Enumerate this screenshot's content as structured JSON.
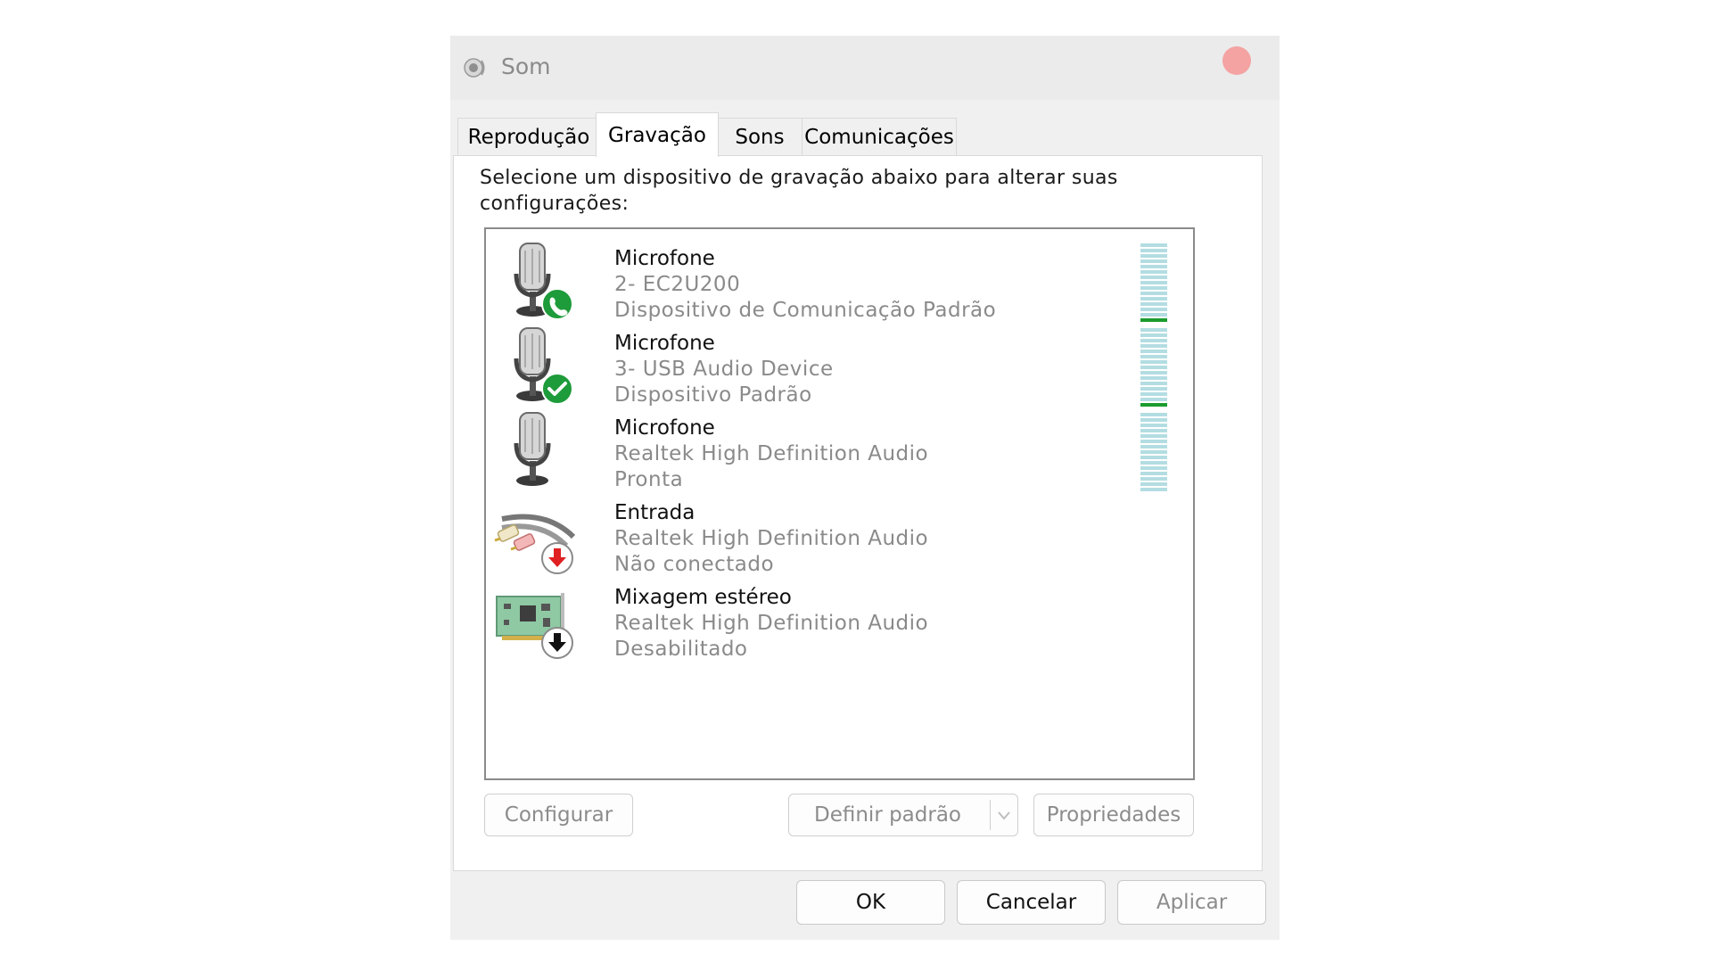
{
  "window": {
    "title": "Som",
    "icon": "speaker-icon"
  },
  "tabs": [
    {
      "label": "Reprodução",
      "active": false
    },
    {
      "label": "Gravação",
      "active": true
    },
    {
      "label": "Sons",
      "active": false
    },
    {
      "label": "Comunicações",
      "active": false
    }
  ],
  "instructions": "Selecione um dispositivo de gravação abaixo para alterar suas configurações:",
  "devices": [
    {
      "name": "Microfone",
      "line2": "2- EC2U200",
      "line3": "Dispositivo de Comunicação Padrão",
      "icon": "microphone-icon",
      "badge": "phone-badge",
      "level_bars": 1
    },
    {
      "name": "Microfone",
      "line2": "3- USB Audio Device",
      "line3": "Dispositivo Padrão",
      "icon": "microphone-icon",
      "badge": "check-badge",
      "level_bars": 1
    },
    {
      "name": "Microfone",
      "line2": "Realtek High Definition Audio",
      "line3": "Pronta",
      "icon": "microphone-icon",
      "badge": "",
      "level_bars": 0
    },
    {
      "name": "Entrada",
      "line2": "Realtek High Definition Audio",
      "line3": "Não conectado",
      "icon": "rca-cable-icon",
      "badge": "red-down-arrow-badge"
    },
    {
      "name": "Mixagem estéreo",
      "line2": "Realtek High Definition Audio",
      "line3": "Desabilitado",
      "icon": "sound-card-icon",
      "badge": "black-down-arrow-badge"
    }
  ],
  "buttons": {
    "configure": "Configurar",
    "set_default": "Definir padrão",
    "properties": "Propriedades",
    "ok": "OK",
    "cancel": "Cancelar",
    "apply": "Aplicar"
  },
  "colors": {
    "meter_empty": "#b3dde2",
    "meter_active": "#1b9c2e",
    "badge_green": "#1e9b3a",
    "badge_red": "#e02020"
  }
}
